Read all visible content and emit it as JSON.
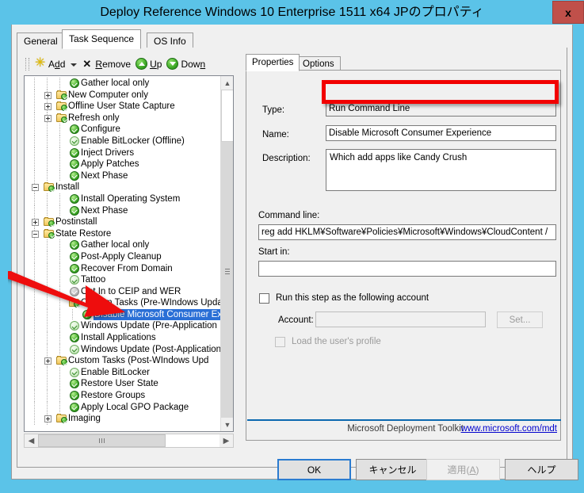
{
  "window": {
    "title": "Deploy Reference Windows 10 Enterprise 1511 x64 JPのプロパティ",
    "close_label": "x",
    "titlebar_color": "#5bc3e8",
    "close_color": "#c0504a"
  },
  "tabs": [
    {
      "label": "General",
      "active": false
    },
    {
      "label": "Task Sequence",
      "active": true
    },
    {
      "label": "OS Info",
      "active": false
    }
  ],
  "toolbar": {
    "add_label": "Add",
    "add_accel": "d",
    "remove_label": "Remove",
    "remove_accel": "R",
    "up_label": "Up",
    "up_accel": "U",
    "down_label": "Down",
    "down_accel": "n"
  },
  "tree": {
    "selection_color": "#2a6fd6",
    "nodes": [
      {
        "label": "Gather local only",
        "indent": 3,
        "icon": "green-check",
        "expander": "none"
      },
      {
        "label": "New Computer only",
        "indent": 2,
        "icon": "folder-green-check",
        "expander": "plus"
      },
      {
        "label": "Offline User State Capture",
        "indent": 2,
        "icon": "folder-green-check",
        "expander": "plus"
      },
      {
        "label": "Refresh only",
        "indent": 2,
        "icon": "folder-green-check",
        "expander": "plus"
      },
      {
        "label": "Configure",
        "indent": 3,
        "icon": "green-check",
        "expander": "none"
      },
      {
        "label": "Enable BitLocker (Offline)",
        "indent": 3,
        "icon": "pale-check",
        "expander": "none"
      },
      {
        "label": "Inject Drivers",
        "indent": 3,
        "icon": "green-check",
        "expander": "none"
      },
      {
        "label": "Apply Patches",
        "indent": 3,
        "icon": "green-check",
        "expander": "none"
      },
      {
        "label": "Next Phase",
        "indent": 3,
        "icon": "green-check",
        "expander": "none"
      },
      {
        "label": "Install",
        "indent": 1,
        "icon": "folder-green-check",
        "expander": "minus"
      },
      {
        "label": "Install Operating System",
        "indent": 3,
        "icon": "green-check",
        "expander": "none"
      },
      {
        "label": "Next Phase",
        "indent": 3,
        "icon": "green-check",
        "expander": "none"
      },
      {
        "label": "Postinstall",
        "indent": 1,
        "icon": "folder-green-check",
        "expander": "plus"
      },
      {
        "label": "State Restore",
        "indent": 1,
        "icon": "folder-green-check",
        "expander": "minus"
      },
      {
        "label": "Gather local only",
        "indent": 3,
        "icon": "green-check",
        "expander": "none"
      },
      {
        "label": "Post-Apply Cleanup",
        "indent": 3,
        "icon": "green-check",
        "expander": "none"
      },
      {
        "label": "Recover From Domain",
        "indent": 3,
        "icon": "green-check",
        "expander": "none"
      },
      {
        "label": "Tattoo",
        "indent": 3,
        "icon": "pale-check",
        "expander": "none"
      },
      {
        "label": "Opt In to CEIP and WER",
        "indent": 3,
        "icon": "gray-check",
        "expander": "none"
      },
      {
        "label": "Custom Tasks (Pre-WIndows Upda",
        "indent": 3,
        "icon": "folder-green-check",
        "expander": "none"
      },
      {
        "label": "Disable Microsoft Consumer Ex",
        "indent": 4,
        "icon": "green-check",
        "expander": "none",
        "selected": true
      },
      {
        "label": "Windows Update (Pre-Application I",
        "indent": 3,
        "icon": "pale-check",
        "expander": "none"
      },
      {
        "label": "Install Applications",
        "indent": 3,
        "icon": "green-check",
        "expander": "none"
      },
      {
        "label": "Windows Update (Post-Application",
        "indent": 3,
        "icon": "pale-check",
        "expander": "none"
      },
      {
        "label": "Custom Tasks (Post-WIndows Upd",
        "indent": 2,
        "icon": "folder-green-check",
        "expander": "plus"
      },
      {
        "label": "Enable BitLocker",
        "indent": 3,
        "icon": "pale-check",
        "expander": "none"
      },
      {
        "label": "Restore User State",
        "indent": 3,
        "icon": "green-check",
        "expander": "none"
      },
      {
        "label": "Restore Groups",
        "indent": 3,
        "icon": "green-check",
        "expander": "none"
      },
      {
        "label": "Apply Local GPO Package",
        "indent": 3,
        "icon": "green-check",
        "expander": "none"
      },
      {
        "label": "Imaging",
        "indent": 2,
        "icon": "folder-green-check",
        "expander": "plus"
      }
    ]
  },
  "properties": {
    "tabs": [
      {
        "label": "Properties",
        "active": true
      },
      {
        "label": "Options",
        "active": false
      }
    ],
    "type_label": "Type:",
    "type_value": "Run Command Line",
    "name_label": "Name:",
    "name_value": "Disable Microsoft Consumer Experience",
    "description_label": "Description:",
    "description_value": "Which add apps like Candy Crush",
    "command_line_label": "Command line:",
    "command_line_value": "reg add HKLM¥Software¥Policies¥Microsoft¥Windows¥CloudContent /",
    "start_in_label": "Start in:",
    "start_in_value": "",
    "run_as_label": "Run this step as the following account",
    "run_as_checked": false,
    "account_label": "Account:",
    "account_value": "",
    "set_button_label": "Set...",
    "load_profile_label": "Load the user's profile",
    "load_profile_checked": false,
    "footer_text": "Microsoft Deployment Toolkit",
    "footer_link": "www.microsoft.com/mdt",
    "footer_link_color": "#0000cd",
    "footer_rule_color": "#0b68b0"
  },
  "dialog_buttons": {
    "ok": "OK",
    "cancel": "キャンセル",
    "apply_pre": "適用(",
    "apply_accel": "A",
    "apply_post": ")",
    "help": "ヘルプ"
  },
  "annotation": {
    "arrow_color": "#ee1111",
    "highlight_color": "#f20000"
  }
}
